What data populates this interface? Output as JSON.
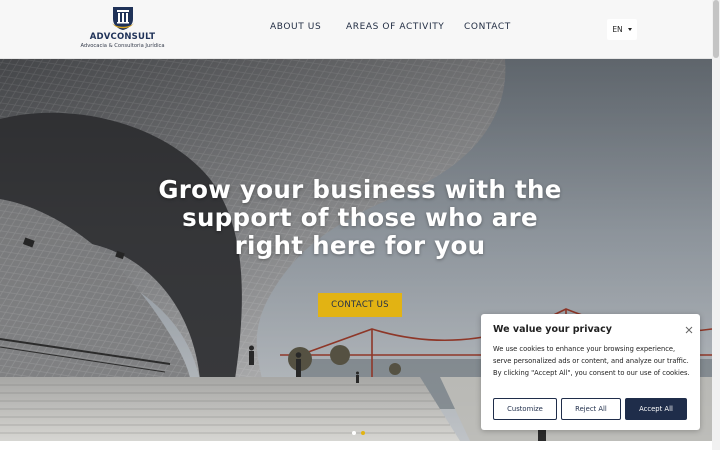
{
  "brand": {
    "name": "ADVCONSULT",
    "tagline": "Advocacia & Consultoria Jurídica",
    "logo_icon": "pillar-shield-logo",
    "colors": {
      "navy": "#1f3258",
      "gold": "#e2b313"
    }
  },
  "nav": {
    "items": [
      {
        "label": "ABOUT US"
      },
      {
        "label": "AREAS OF ACTIVITY"
      },
      {
        "label": "CONTACT"
      }
    ],
    "language": {
      "label": "EN",
      "icon": "caret-down-icon"
    }
  },
  "hero": {
    "title": "Grow your business with the support of those who are right here for you",
    "cta_label": "CONTACT US",
    "slides": {
      "count": 2,
      "active_index": 0
    }
  },
  "cookie_banner": {
    "title": "We value your privacy",
    "text": "We use cookies to enhance your browsing experience, serve personalized ads or content, and analyze our traffic. By clicking \"Accept All\", you consent to our use of cookies.",
    "buttons": {
      "customize": "Customize",
      "reject": "Reject All",
      "accept": "Accept All"
    },
    "close_icon": "close-icon"
  }
}
